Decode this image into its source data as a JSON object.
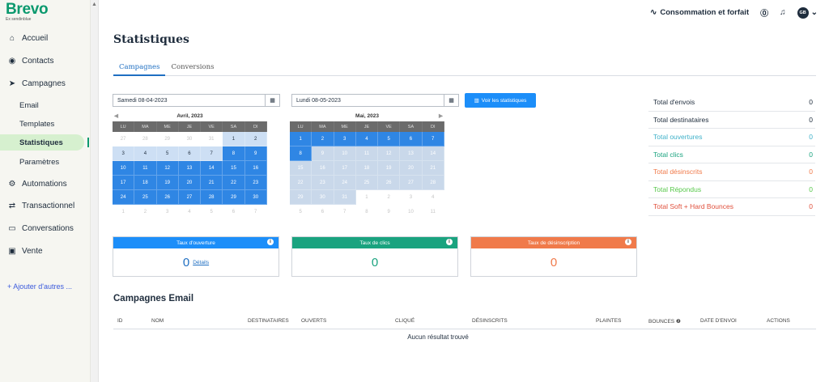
{
  "brand": {
    "name": "Brevo",
    "sub": "Ex sendinblue"
  },
  "sidebar": {
    "items": [
      {
        "label": "Accueil",
        "icon": "home-icon",
        "glyph": "⌂"
      },
      {
        "label": "Contacts",
        "icon": "contacts-icon",
        "glyph": "◉"
      },
      {
        "label": "Campagnes",
        "icon": "send-icon",
        "glyph": "➤"
      },
      {
        "label": "Automations",
        "icon": "automation-icon",
        "glyph": "⚙"
      },
      {
        "label": "Transactionnel",
        "icon": "transfer-icon",
        "glyph": "⇄"
      },
      {
        "label": "Conversations",
        "icon": "chat-icon",
        "glyph": "▭"
      },
      {
        "label": "Vente",
        "icon": "sales-icon",
        "glyph": "▣"
      }
    ],
    "subitems": [
      "Email",
      "Templates",
      "Statistiques",
      "Paramètres"
    ],
    "active_subitem": "Statistiques",
    "add_more": "+  Ajouter d'autres ..."
  },
  "topbar": {
    "plan_label": "Consommation et forfait",
    "avatar_initials": "GB"
  },
  "page": {
    "title": "Statistiques"
  },
  "tabs": [
    {
      "label": "Campagnes",
      "active": true
    },
    {
      "label": "Conversions",
      "active": false
    }
  ],
  "date_from": {
    "value": "Samedi 08-04-2023"
  },
  "date_to": {
    "value": "Lundi 08-05-2023"
  },
  "stats_button": "Voir les statistiques",
  "calendars": [
    {
      "month": "Avril, 2023",
      "weekdays": [
        "LU",
        "MA",
        "ME",
        "JE",
        "VE",
        "SA",
        "DI"
      ],
      "days": [
        "27",
        "28",
        "29",
        "30",
        "31",
        "1",
        "2",
        "3",
        "4",
        "5",
        "6",
        "7",
        "8",
        "9",
        "10",
        "11",
        "12",
        "13",
        "14",
        "15",
        "16",
        "17",
        "18",
        "19",
        "20",
        "21",
        "22",
        "23",
        "24",
        "25",
        "26",
        "27",
        "28",
        "29",
        "30",
        "1",
        "2",
        "3",
        "4",
        "5",
        "6",
        "7"
      ],
      "states": [
        "out",
        "out",
        "out",
        "out",
        "out",
        "edge",
        "edge",
        "edge",
        "edge",
        "edge",
        "edge",
        "edge",
        "range",
        "range",
        "range",
        "range",
        "range",
        "range",
        "range",
        "range",
        "range",
        "range",
        "range",
        "range",
        "range",
        "range",
        "range",
        "range",
        "range",
        "range",
        "range",
        "range",
        "range",
        "range",
        "range",
        "normal",
        "normal",
        "normal",
        "normal",
        "normal",
        "normal",
        "normal"
      ]
    },
    {
      "month": "Mai, 2023",
      "weekdays": [
        "LU",
        "MA",
        "ME",
        "JE",
        "VE",
        "SA",
        "DI"
      ],
      "days": [
        "1",
        "2",
        "3",
        "4",
        "5",
        "6",
        "7",
        "8",
        "9",
        "10",
        "11",
        "12",
        "13",
        "14",
        "15",
        "16",
        "17",
        "18",
        "19",
        "20",
        "21",
        "22",
        "23",
        "24",
        "25",
        "26",
        "27",
        "28",
        "29",
        "30",
        "31",
        "1",
        "2",
        "3",
        "4",
        "5",
        "6",
        "7",
        "8",
        "9",
        "10",
        "11"
      ],
      "states": [
        "range",
        "range",
        "range",
        "range",
        "range",
        "range",
        "range",
        "range",
        "grey",
        "grey",
        "grey",
        "grey",
        "grey",
        "grey",
        "grey",
        "grey",
        "grey",
        "grey",
        "grey",
        "grey",
        "grey",
        "grey",
        "grey",
        "grey",
        "grey",
        "grey",
        "grey",
        "grey",
        "grey",
        "grey",
        "grey",
        "normal",
        "normal",
        "normal",
        "normal",
        "normal",
        "normal",
        "normal",
        "normal",
        "normal",
        "normal",
        "normal"
      ]
    }
  ],
  "cards": [
    {
      "title": "Taux d'ouverture",
      "value": "0",
      "link": "Détails",
      "color": "#1c8ef9",
      "value_color": "#1f6fc2"
    },
    {
      "title": "Taux de clics",
      "value": "0",
      "link": "",
      "color": "#1aa37f",
      "value_color": "#1aa37f"
    },
    {
      "title": "Taux de désinscription",
      "value": "0",
      "link": "",
      "color": "#f07a4a",
      "value_color": "#f07a4a"
    }
  ],
  "totals": [
    {
      "label": "Total d'envois",
      "value": "0",
      "color": "#1f2d3d"
    },
    {
      "label": "Total destinataires",
      "value": "0",
      "color": "#1f2d3d"
    },
    {
      "label": "Total ouvertures",
      "value": "0",
      "color": "#3fb1c9"
    },
    {
      "label": "Total clics",
      "value": "0",
      "color": "#1aa37f"
    },
    {
      "label": "Total désinscrits",
      "value": "0",
      "color": "#f07a4a"
    },
    {
      "label": "Total Répondus",
      "value": "0",
      "color": "#58c84b"
    },
    {
      "label": "Total Soft + Hard Bounces",
      "value": "0",
      "color": "#e0503c"
    }
  ],
  "email_section": {
    "title": "Campagnes Email",
    "columns": [
      "ID",
      "NOM",
      "DESTINATAIRES",
      "OUVERTS",
      "CLIQUÉ",
      "DÉSINSCRITS",
      "PLAINTES",
      "BOUNCES ❷",
      "DATE D'ENVOI",
      "ACTIONS"
    ],
    "empty_text": "Aucun résultat trouvé"
  }
}
